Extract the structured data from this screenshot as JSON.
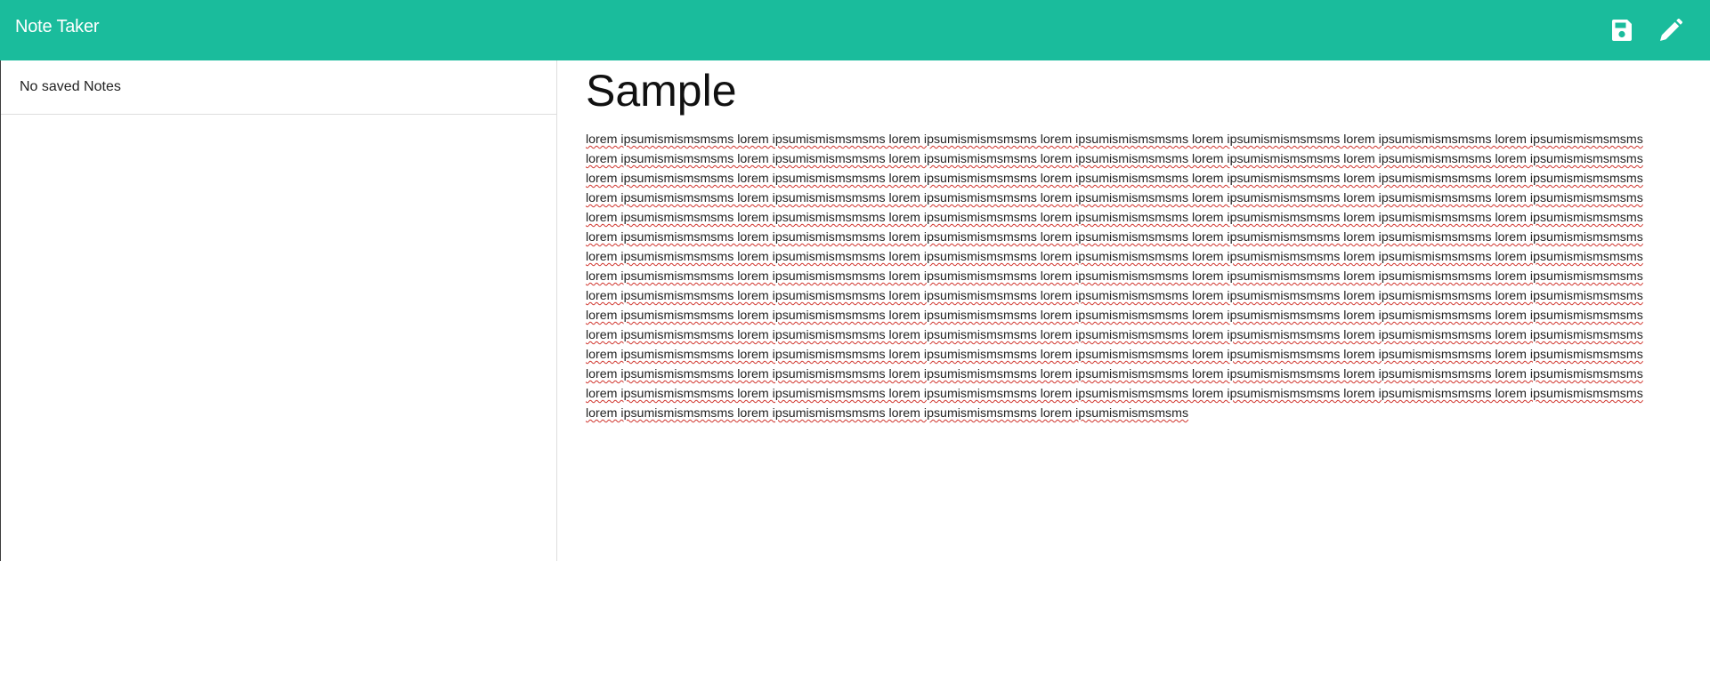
{
  "navbar": {
    "brand": "Note Taker",
    "background": "#1abc9c",
    "save_icon": "floppy-disk-icon",
    "edit_icon": "pencil-icon"
  },
  "sidebar": {
    "empty_text": "No saved Notes"
  },
  "note": {
    "title": "Sample",
    "body": "lorem ipsumismismsmsms lorem ipsumismismsmsms lorem ipsumismismsmsms lorem ipsumismismsmsms lorem ipsumismismsmsms lorem ipsumismismsmsms lorem ipsumismismsmsms lorem ipsumismismsmsms lorem ipsumismismsmsms lorem ipsumismismsmsms lorem ipsumismismsmsms lorem ipsumismismsmsms lorem ipsumismismsmsms lorem ipsumismismsmsms lorem ipsumismismsmsms lorem ipsumismismsmsms lorem ipsumismismsmsms lorem ipsumismismsmsms lorem ipsumismismsmsms lorem ipsumismismsmsms lorem ipsumismismsmsms lorem ipsumismismsmsms lorem ipsumismismsmsms lorem ipsumismismsmsms lorem ipsumismismsmsms lorem ipsumismismsmsms lorem ipsumismismsmsms lorem ipsumismismsmsms lorem ipsumismismsmsms lorem ipsumismismsmsms lorem ipsumismismsmsms lorem ipsumismismsmsms lorem ipsumismismsmsms lorem ipsumismismsmsms lorem ipsumismismsmsms lorem ipsumismismsmsms lorem ipsumismismsmsms lorem ipsumismismsmsms lorem ipsumismismsmsms lorem ipsumismismsmsms lorem ipsumismismsmsms lorem ipsumismismsmsms lorem ipsumismismsmsms lorem ipsumismismsmsms lorem ipsumismismsmsms lorem ipsumismismsmsms lorem ipsumismismsmsms lorem ipsumismismsmsms lorem ipsumismismsmsms lorem ipsumismismsmsms lorem ipsumismismsmsms lorem ipsumismismsmsms lorem ipsumismismsmsms lorem ipsumismismsmsms lorem ipsumismismsmsms lorem ipsumismismsmsms lorem ipsumismismsmsms lorem ipsumismismsmsms lorem ipsumismismsmsms lorem ipsumismismsmsms lorem ipsumismismsmsms lorem ipsumismismsmsms lorem ipsumismismsmsms lorem ipsumismismsmsms lorem ipsumismismsmsms lorem ipsumismismsmsms lorem ipsumismismsmsms lorem ipsumismismsmsms lorem ipsumismismsmsms lorem ipsumismismsmsms lorem ipsumismismsmsms lorem ipsumismismsmsms lorem ipsumismismsmsms lorem ipsumismismsmsms lorem ipsumismismsmsms lorem ipsumismismsmsms lorem ipsumismismsmsms lorem ipsumismismsmsms lorem ipsumismismsmsms lorem ipsumismismsmsms lorem ipsumismismsmsms lorem ipsumismismsmsms lorem ipsumismismsmsms lorem ipsumismismsmsms lorem ipsumismismsmsms lorem ipsumismismsmsms lorem ipsumismismsmsms lorem ipsumismismsmsms lorem ipsumismismsmsms lorem ipsumismismsmsms lorem ipsumismismsmsms lorem ipsumismismsmsms lorem ipsumismismsmsms lorem ipsumismismsmsms lorem ipsumismismsmsms lorem ipsumismismsmsms lorem ipsumismismsmsms lorem ipsumismismsmsms lorem ipsumismismsmsms lorem ipsumismismsmsms lorem ipsumismismsmsms lorem ipsumismismsmsms"
  }
}
